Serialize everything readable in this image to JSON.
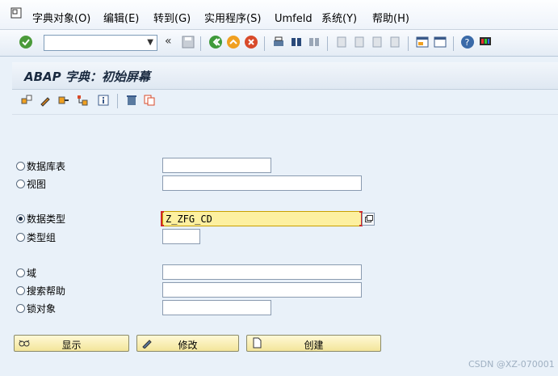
{
  "menubar": {
    "items": [
      {
        "label": "字典对象(O)"
      },
      {
        "label": "编辑(E)"
      },
      {
        "label": "转到(G)"
      },
      {
        "label": "实用程序(S)"
      },
      {
        "label": "Umfeld"
      },
      {
        "label": "系统(Y)"
      },
      {
        "label": "帮助(H)"
      }
    ]
  },
  "toolbar": {
    "command_field": "",
    "icons": [
      "enter-icon",
      "back-arrows-icon",
      "save-icon",
      "back-icon",
      "exit-icon",
      "cancel-icon",
      "print-icon",
      "find-icon",
      "find-next-icon",
      "first-page-icon",
      "prev-page-icon",
      "next-page-icon",
      "last-page-icon",
      "new-session-icon",
      "shortcut-icon",
      "help-icon",
      "customize-layout-icon"
    ]
  },
  "title": "ABAP 字典：初始屏幕",
  "app_toolbar": {
    "icons": [
      "other-object-icon",
      "edit-pencil-icon",
      "where-used-icon",
      "hierarchy-icon",
      "info-icon",
      "delete-icon",
      "copy-icon"
    ]
  },
  "options": [
    {
      "label": "数据库表",
      "value": "",
      "selected": false
    },
    {
      "label": "视图",
      "value": "",
      "selected": false
    },
    {
      "label": "数据类型",
      "value": "Z_ZFG_CD",
      "selected": true
    },
    {
      "label": "类型组",
      "value": "",
      "selected": false
    },
    {
      "label": "域",
      "value": "",
      "selected": false
    },
    {
      "label": "搜索帮助",
      "value": "",
      "selected": false
    },
    {
      "label": "锁对象",
      "value": "",
      "selected": false
    }
  ],
  "buttons": {
    "display": "显示",
    "change": "修改",
    "create": "创建"
  },
  "watermark": "CSDN @XZ-070001"
}
